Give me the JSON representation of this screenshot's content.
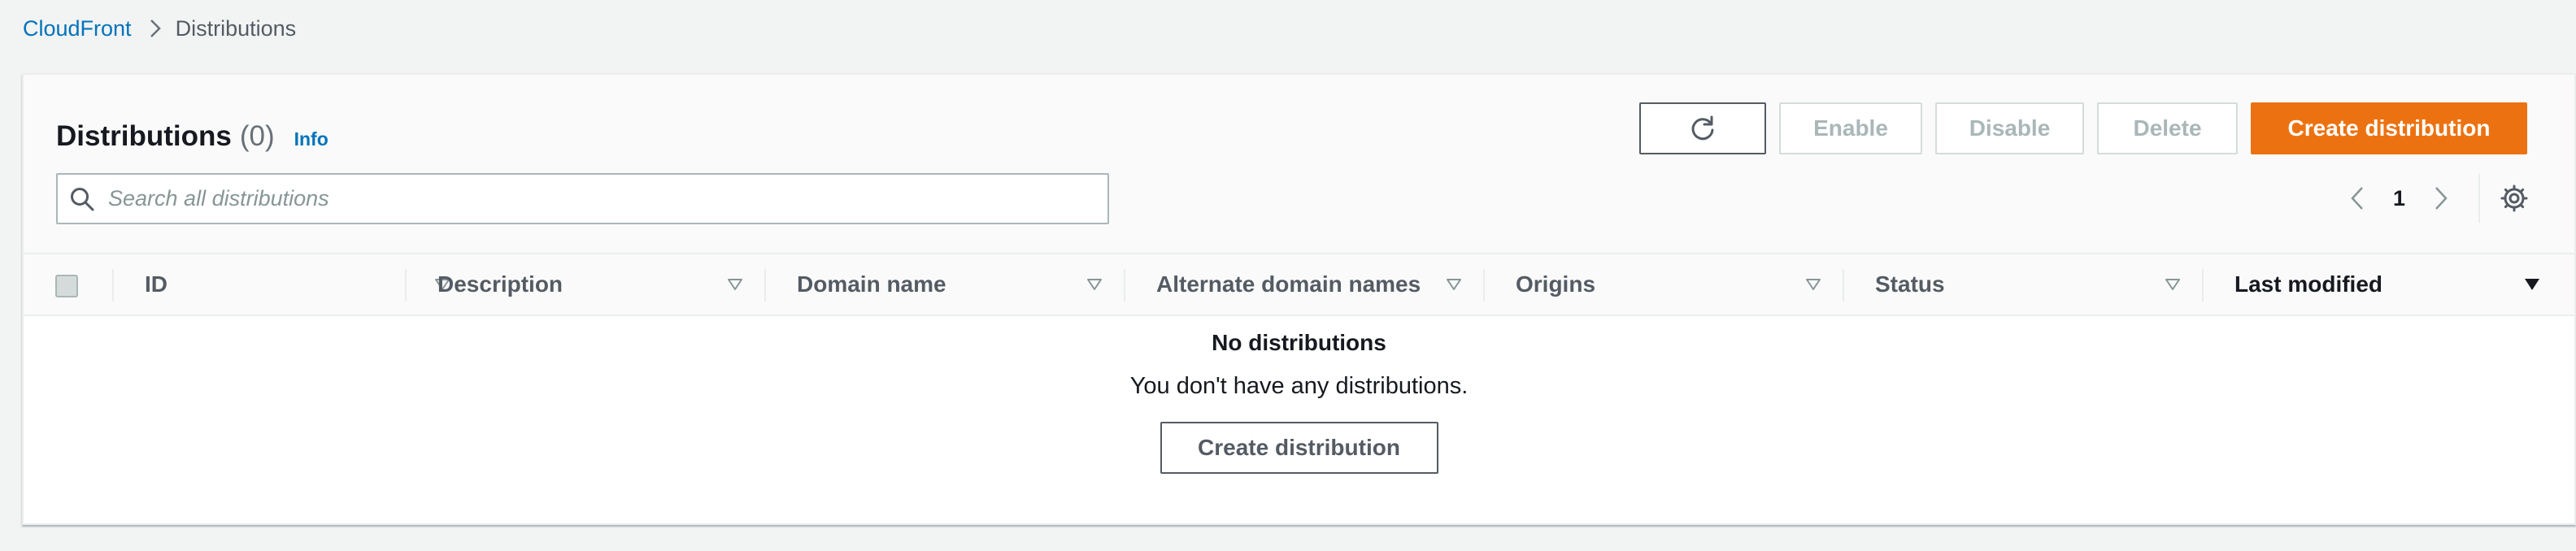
{
  "breadcrumb": {
    "items": [
      {
        "label": "CloudFront",
        "link": true
      },
      {
        "label": "Distributions",
        "link": false
      }
    ]
  },
  "header": {
    "title": "Distributions",
    "count": "(0)",
    "info": "Info"
  },
  "actions": {
    "refresh_icon": "refresh-icon",
    "enable": "Enable",
    "disable": "Disable",
    "delete": "Delete",
    "create": "Create distribution"
  },
  "search": {
    "placeholder": "Search all distributions",
    "value": ""
  },
  "pagination": {
    "current_page": "1"
  },
  "table": {
    "columns": [
      "ID",
      "Description",
      "Domain name",
      "Alternate domain names",
      "Origins",
      "Status",
      "Last modified"
    ],
    "sorted_column": "Last modified",
    "sort_direction": "descending"
  },
  "empty_state": {
    "title": "No distributions",
    "description": "You don't have any distributions.",
    "button": "Create distribution"
  },
  "colors": {
    "primary": "#ec7211",
    "link": "#0073bb",
    "page_bg": "#f2f3f3"
  }
}
